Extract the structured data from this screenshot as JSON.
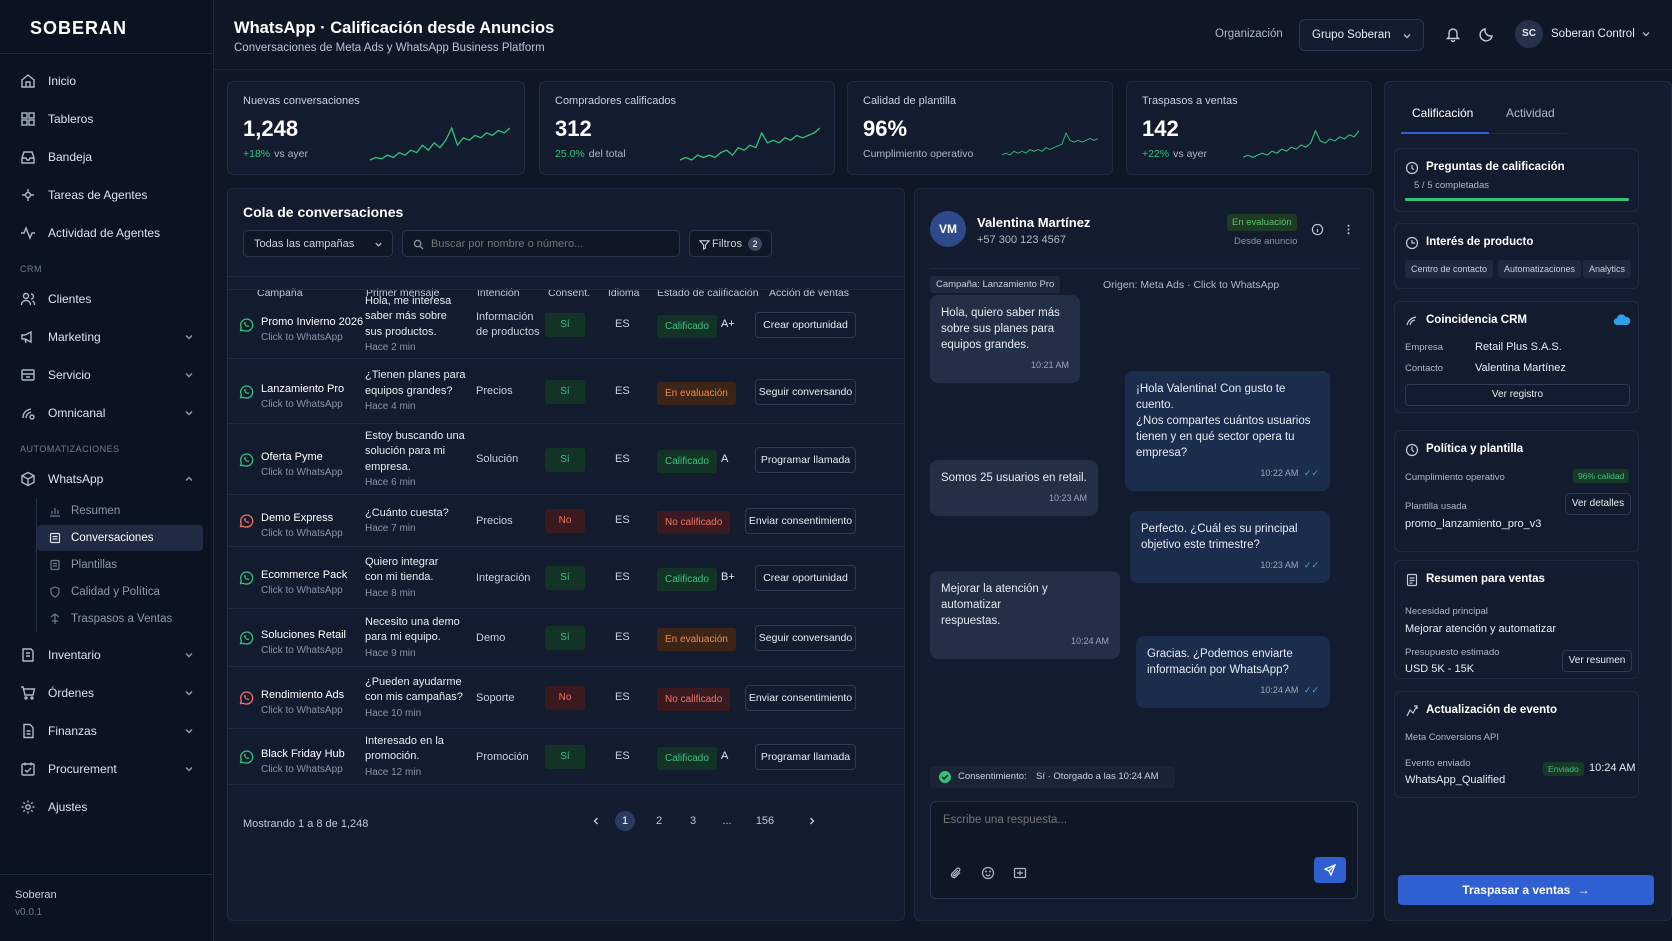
{
  "brand": "SOBERAN",
  "sidebar": {
    "items": [
      {
        "label": "Inicio"
      },
      {
        "label": "Tableros"
      },
      {
        "label": "Bandeja"
      },
      {
        "label": "Tareas de Agentes"
      },
      {
        "label": "Actividad de Agentes"
      }
    ],
    "crm_label": "CRM",
    "crm_items": [
      {
        "label": "Clientes"
      },
      {
        "label": "Marketing"
      },
      {
        "label": "Servicio"
      },
      {
        "label": "Omnicanal"
      }
    ],
    "auto_label": "AUTOMATIZACIONES",
    "whatsapp": "WhatsApp",
    "whatsapp_sub": [
      {
        "label": "Resumen"
      },
      {
        "label": "Conversaciones"
      },
      {
        "label": "Plantillas"
      },
      {
        "label": "Calidad y Política"
      },
      {
        "label": "Traspasos a Ventas"
      }
    ],
    "bottom_items": [
      {
        "label": "Inventario"
      },
      {
        "label": "Órdenes"
      },
      {
        "label": "Finanzas"
      },
      {
        "label": "Procurement"
      },
      {
        "label": "Ajustes"
      }
    ],
    "footer_name": "Soberan",
    "footer_version": "v0.0.1"
  },
  "header": {
    "title": "WhatsApp · Calificación desde Anuncios",
    "subtitle": "Conversaciones de Meta Ads y WhatsApp Business Platform",
    "org_label": "Organización",
    "org_value": "Grupo Soberan",
    "user_initials": "SC",
    "user_name": "Soberan Control"
  },
  "kpis": [
    {
      "label": "Nuevas conversaciones",
      "value": "1,248",
      "delta": "+18%",
      "note": "vs ayer",
      "trend": [
        3,
        4,
        3.5,
        5,
        4,
        6,
        5,
        7,
        6,
        9,
        7,
        10,
        8,
        11,
        16,
        9,
        12,
        11,
        13,
        12,
        14,
        13,
        15,
        14,
        16
      ]
    },
    {
      "label": "Compradores calificados",
      "value": "312",
      "delta": "25.0%",
      "note": "del total",
      "trend": [
        3,
        4,
        3,
        5,
        4,
        5,
        4,
        6,
        7,
        5,
        8,
        7,
        9,
        8,
        14,
        10,
        11,
        10,
        12,
        11,
        13,
        12,
        13,
        14,
        16
      ]
    },
    {
      "label": "Calidad de plantilla",
      "value": "96%",
      "delta": "",
      "note": "Cumplimiento operativo",
      "trend": [
        4,
        5,
        4,
        6,
        5,
        6,
        5,
        7,
        6,
        7,
        6,
        8,
        7,
        8,
        9,
        10,
        16,
        12,
        11,
        12,
        11,
        12,
        13,
        12,
        13
      ]
    },
    {
      "label": "Traspasos a ventas",
      "value": "142",
      "delta": "+22%",
      "note": "vs ayer",
      "trend": [
        3,
        4,
        3,
        4,
        5,
        4,
        6,
        5,
        7,
        6,
        8,
        7,
        9,
        8,
        10,
        16,
        11,
        10,
        12,
        11,
        13,
        12,
        14,
        13,
        16
      ]
    }
  ],
  "queue": {
    "title": "Cola de conversaciones",
    "campaign_filter": "Todas las campañas",
    "search_placeholder": "Buscar por nombre o número...",
    "filters_label": "Filtros",
    "filters_count": "2",
    "columns": [
      "Campaña",
      "Primer mensaje",
      "Intención",
      "Consent.",
      "Idioma",
      "Estado de calificación",
      "Acción de ventas"
    ],
    "rows": [
      {
        "campaign": "Promo Invierno 2026",
        "source": "Click to WhatsApp",
        "msg": [
          "Hola, me interesa",
          "saber más sobre",
          "sus productos."
        ],
        "time": "Hace 2 min",
        "intent": [
          "Información",
          "de productos"
        ],
        "consent": "Sí",
        "lang": "ES",
        "status": "Calificado",
        "grade": "A+",
        "action": "Crear oportunidad"
      },
      {
        "campaign": "Lanzamiento Pro",
        "source": "Click to WhatsApp",
        "msg": [
          "¿Tienen planes para",
          "equipos grandes?"
        ],
        "time": "Hace 4 min",
        "intent": [
          "Precios"
        ],
        "consent": "Sí",
        "lang": "ES",
        "status": "En evaluación",
        "grade": "",
        "action": "Seguir conversando"
      },
      {
        "campaign": "Oferta Pyme",
        "source": "Click to WhatsApp",
        "msg": [
          "Estoy buscando una",
          "solución para mi",
          "empresa."
        ],
        "time": "Hace 6 min",
        "intent": [
          "Solución"
        ],
        "consent": "Sí",
        "lang": "ES",
        "status": "Calificado",
        "grade": "A",
        "action": "Programar llamada"
      },
      {
        "campaign": "Demo Express",
        "source": "Click to WhatsApp",
        "msg": [
          "¿Cuánto cuesta?"
        ],
        "time": "Hace 7 min",
        "intent": [
          "Precios"
        ],
        "consent": "No",
        "lang": "ES",
        "status": "No calificado",
        "grade": "",
        "action": "Enviar consentimiento"
      },
      {
        "campaign": "Ecommerce Pack",
        "source": "Click to WhatsApp",
        "msg": [
          "Quiero integrar",
          "con mi tienda."
        ],
        "time": "Hace 8 min",
        "intent": [
          "Integración"
        ],
        "consent": "Sí",
        "lang": "ES",
        "status": "Calificado",
        "grade": "B+",
        "action": "Crear oportunidad"
      },
      {
        "campaign": "Soluciones Retail",
        "source": "Click to WhatsApp",
        "msg": [
          "Necesito una demo",
          "para mi equipo."
        ],
        "time": "Hace 9 min",
        "intent": [
          "Demo"
        ],
        "consent": "Sí",
        "lang": "ES",
        "status": "En evaluación",
        "grade": "",
        "action": "Seguir conversando"
      },
      {
        "campaign": "Rendimiento Ads",
        "source": "Click to WhatsApp",
        "msg": [
          "¿Pueden ayudarme",
          "con mis campañas?"
        ],
        "time": "Hace 10 min",
        "intent": [
          "Soporte"
        ],
        "consent": "No",
        "lang": "ES",
        "status": "No calificado",
        "grade": "",
        "action": "Enviar consentimiento"
      },
      {
        "campaign": "Black Friday Hub",
        "source": "Click to WhatsApp",
        "msg": [
          "Interesado en la",
          "promoción."
        ],
        "time": "Hace 12 min",
        "intent": [
          "Promoción"
        ],
        "consent": "Sí",
        "lang": "ES",
        "status": "Calificado",
        "grade": "A",
        "action": "Programar llamada"
      }
    ],
    "showing": "Mostrando 1 a 8 de 1,248",
    "pages": [
      "1",
      "2",
      "3",
      "...",
      "156"
    ]
  },
  "chat": {
    "initials": "VM",
    "name": "Valentina Martínez",
    "phone": "+57 300 123 4567",
    "status": "En evaluación",
    "source": "Desde anuncio",
    "campaign_tag": "Campaña: Lanzamiento Pro",
    "origin": "Origen: Meta Ads · Click to WhatsApp",
    "messages": [
      {
        "dir": "in",
        "lines": [
          "Hola, quiero saber más",
          "sobre sus planes para",
          "equipos grandes."
        ],
        "time": "10:21 AM"
      },
      {
        "dir": "out",
        "lines": [
          "¡Hola Valentina! Con gusto te cuento.",
          "¿Nos compartes cuántos usuarios",
          "tienen y en qué sector opera tu",
          "empresa?"
        ],
        "time": "10:22 AM"
      },
      {
        "dir": "in",
        "lines": [
          "Somos 25 usuarios en retail."
        ],
        "time": "10:23 AM"
      },
      {
        "dir": "out",
        "lines": [
          "Perfecto. ¿Cuál es su principal",
          "objetivo este trimestre?"
        ],
        "time": "10:23 AM"
      },
      {
        "dir": "in",
        "lines": [
          "Mejorar la atención y automatizar",
          "respuestas."
        ],
        "time": "10:24 AM"
      },
      {
        "dir": "out",
        "lines": [
          "Gracias. ¿Podemos enviarte",
          "información por WhatsApp?"
        ],
        "time": "10:24 AM"
      }
    ],
    "consent_label": "Consentimiento:",
    "consent_value": "Sí · Otorgado a las 10:24 AM",
    "reply_placeholder": "Escribe una respuesta..."
  },
  "panel": {
    "tabs": [
      "Calificación",
      "Actividad"
    ],
    "questions_title": "Preguntas de calificación",
    "questions_progress": "5 / 5 completadas",
    "questions_fraction": 1.0,
    "interest_title": "Interés de producto",
    "interest_chips": [
      "Centro de contacto",
      "Automatizaciones",
      "Analytics"
    ],
    "crm_title": "Coincidencia CRM",
    "crm_company_label": "Empresa",
    "crm_company": "Retail Plus S.A.S.",
    "crm_contact_label": "Contacto",
    "crm_contact": "Valentina Martínez",
    "crm_button": "Ver registro",
    "policy_title": "Política y plantilla",
    "policy_compliance_label": "Cumplimiento operativo",
    "policy_compliance_value": "96% calidad",
    "policy_template_label": "Plantilla usada",
    "policy_template": "promo_lanzamiento_pro_v3",
    "policy_button": "Ver detalles",
    "summary_title": "Resumen para ventas",
    "summary_need_label": "Necesidad principal",
    "summary_need": "Mejorar atención y automatizar",
    "summary_budget_label": "Presupuesto estimado",
    "summary_budget": "USD 5K - 15K",
    "summary_button": "Ver resumen",
    "event_title": "Actualización de evento",
    "event_api": "Meta Conversions API",
    "event_sent_label": "Evento enviado",
    "event_name": "WhatsApp_Qualified",
    "event_badge": "Enviado",
    "event_time": "10:24 AM",
    "handoff_button": "Traspasar a ventas"
  },
  "colors": {
    "accent": "#2f5fd0",
    "positive": "#34c27a",
    "warning": "#f08a4b",
    "negative": "#f07366"
  }
}
